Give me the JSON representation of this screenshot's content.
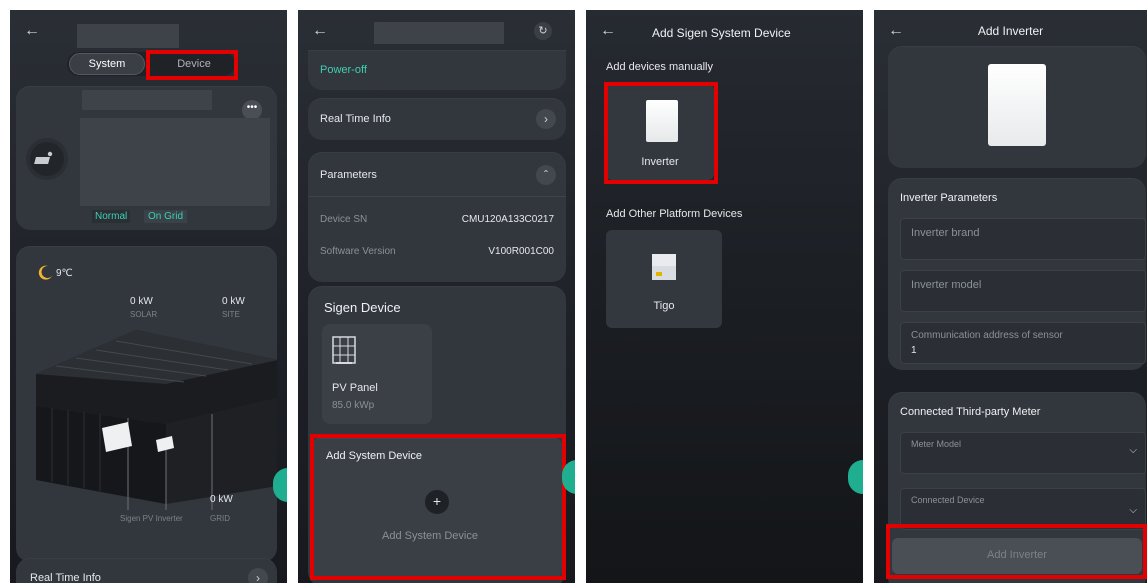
{
  "panel1": {
    "tab_system": "System",
    "tab_device": "Device",
    "status_normal": "Normal",
    "status_grid": "On Grid",
    "weather_temp": "9℃",
    "solar_value": "0 kW",
    "solar_label": "SOLAR",
    "site_value": "0 kW",
    "site_label": "SITE",
    "grid_value": "0 kW",
    "grid_label": "GRID",
    "inverter_label": "Sigen PV Inverter",
    "bottom_row": "Real Time Info"
  },
  "panel2": {
    "power_off": "Power-off",
    "real_time_info": "Real Time Info",
    "parameters": "Parameters",
    "device_sn_label": "Device SN",
    "device_sn_value": "CMU120A133C0217",
    "software_version_label": "Software Version",
    "software_version_value": "V100R001C00",
    "sigen_device_title": "Sigen Device",
    "pv_panel_label": "PV Panel",
    "pv_panel_value": "85.0 kWp",
    "add_system_device_title": "Add System Device",
    "add_system_device_button": "Add System Device"
  },
  "panel3": {
    "title": "Add Sigen System Device",
    "manual_heading": "Add devices manually",
    "inverter_label": "Inverter",
    "other_heading": "Add Other Platform Devices",
    "tigo_label": "Tigo"
  },
  "panel4": {
    "title": "Add Inverter",
    "params_heading": "Inverter Parameters",
    "brand_placeholder": "Inverter brand",
    "model_placeholder": "Inverter model",
    "comm_label": "Communication address of sensor",
    "comm_value": "1",
    "meter_heading": "Connected Third-party Meter",
    "meter_model_placeholder": "Meter Model",
    "connected_device_placeholder": "Connected Device",
    "add_button": "Add Inverter"
  },
  "colors": {
    "accent_teal": "#3fd0b0",
    "highlight_red": "#e30000",
    "panel_bg": "#2a2e35"
  }
}
